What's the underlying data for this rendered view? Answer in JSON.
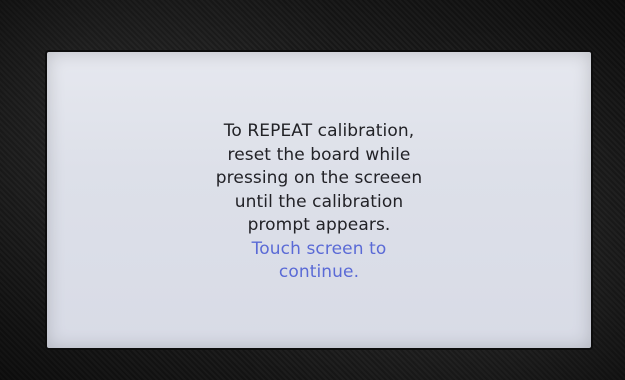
{
  "screen": {
    "message_lines": [
      "To REPEAT calibration,",
      "reset the board while",
      "pressing on the screeen",
      "until the calibration",
      "prompt appears."
    ],
    "action_lines": [
      "Touch screen to",
      "continue."
    ]
  },
  "colors": {
    "bezel": "#1b1b1b",
    "screen_background": "#dde0e9",
    "message_text": "#222227",
    "action_text": "#5a6ad6"
  }
}
